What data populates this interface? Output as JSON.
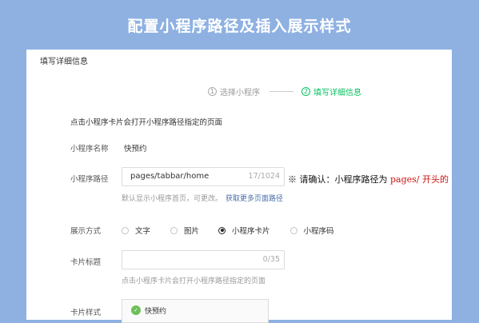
{
  "banner": {
    "title": "配置小程序路径及插入展示样式"
  },
  "panel": {
    "title": "填写详细信息"
  },
  "steps": [
    {
      "num": "1",
      "label": "选择小程序"
    },
    {
      "num": "2",
      "label": "填写详细信息"
    }
  ],
  "form": {
    "intro": "点击小程序卡片会打开小程序路径指定的页面",
    "name_label": "小程序名称",
    "name_value": "快预约",
    "path_label": "小程序路径",
    "path_value": "pages/tabbar/home",
    "path_count": "17/1024",
    "path_hint": "默认显示小程序首页，可更改。",
    "path_link": "获取更多页面路径",
    "note_prefix": "※ 请确认：小程序路径为 ",
    "note_red": "pages/ 开头的",
    "display_label": "展示方式",
    "display_options": [
      "文字",
      "图片",
      "小程序卡片",
      "小程序码"
    ],
    "display_selected": "小程序卡片",
    "card_title_label": "卡片标题",
    "card_title_count": "0/35",
    "card_title_hint": "点击小程序卡片会打开小程序路径指定的页面",
    "card_style_label": "卡片样式",
    "card_preview_name": "快预约"
  }
}
